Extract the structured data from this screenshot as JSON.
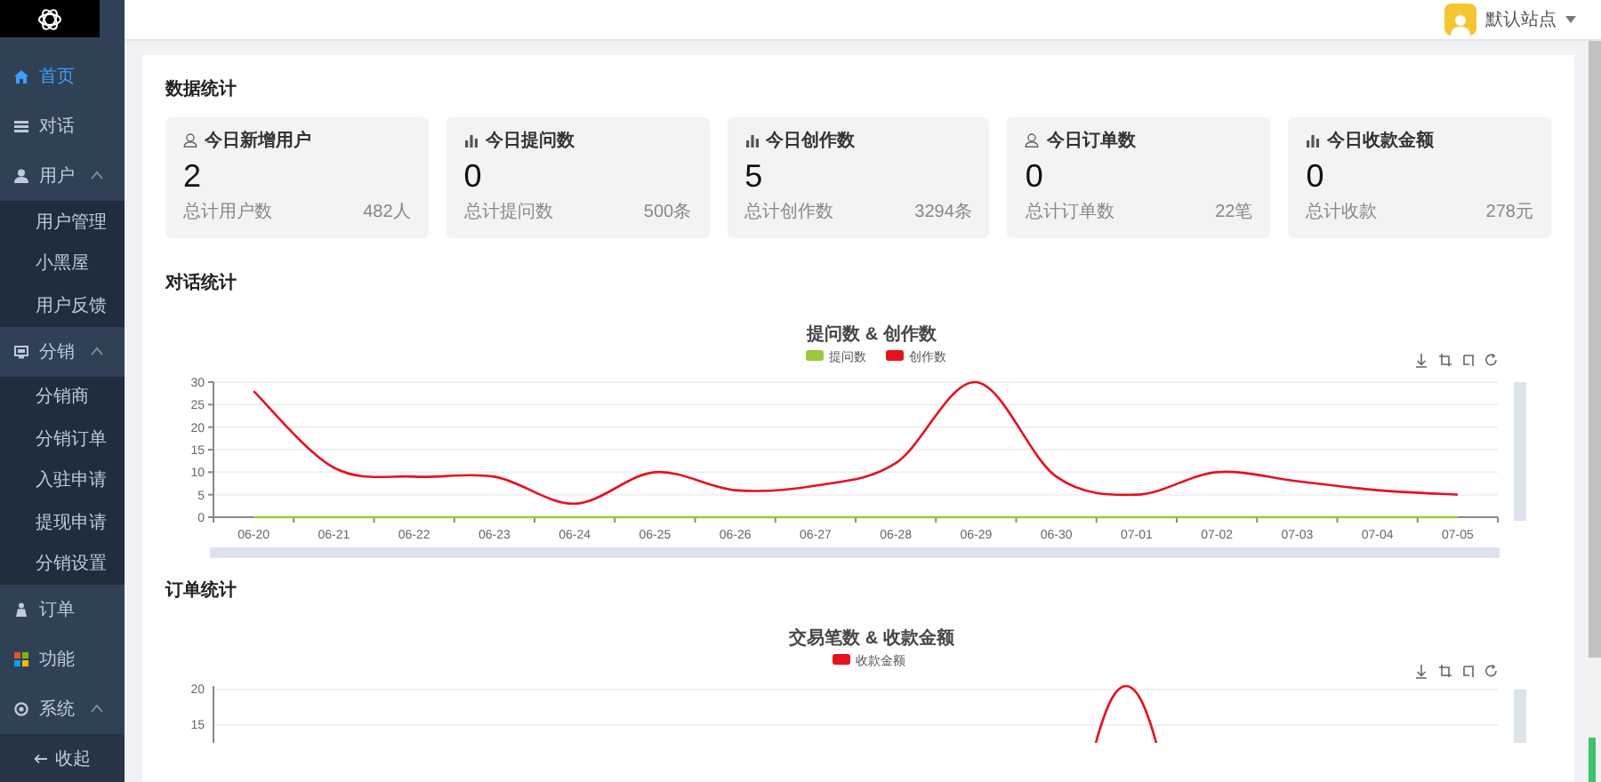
{
  "header": {
    "site": "默认站点"
  },
  "sidebar": {
    "items": [
      {
        "label": "首页",
        "selected": true
      },
      {
        "label": "对话",
        "selected": false
      },
      {
        "label": "用户",
        "selected": false,
        "expanded": true,
        "children": [
          {
            "label": "用户管理",
            "selected": false
          },
          {
            "label": "小黑屋",
            "selected": false
          },
          {
            "label": "用户反馈",
            "selected": false
          }
        ]
      },
      {
        "label": "分销",
        "selected": false,
        "expanded": true,
        "children": [
          {
            "label": "分销商",
            "selected": false
          },
          {
            "label": "分销订单",
            "selected": false
          },
          {
            "label": "入驻申请",
            "selected": false
          },
          {
            "label": "提现申请",
            "selected": false
          },
          {
            "label": "分销设置",
            "selected": false
          }
        ]
      },
      {
        "label": "订单",
        "selected": false
      },
      {
        "label": "功能",
        "selected": false
      },
      {
        "label": "系统",
        "selected": false,
        "expanded": true
      }
    ],
    "collapse": "收起"
  },
  "stats": {
    "title": "数据统计",
    "cards": [
      {
        "kind": "user",
        "title": "今日新增用户",
        "value": "2",
        "total_label": "总计用户数",
        "total_value": "482人"
      },
      {
        "kind": "chart",
        "title": "今日提问数",
        "value": "0",
        "total_label": "总计提问数",
        "total_value": "500条"
      },
      {
        "kind": "chart",
        "title": "今日创作数",
        "value": "5",
        "total_label": "总计创作数",
        "total_value": "3294条"
      },
      {
        "kind": "user",
        "title": "今日订单数",
        "value": "0",
        "total_label": "总计订单数",
        "total_value": "22笔"
      },
      {
        "kind": "chart",
        "title": "今日收款金额",
        "value": "0",
        "total_label": "总计收款",
        "total_value": "278元"
      }
    ]
  },
  "conversation_section": {
    "title": "对话统计",
    "chart_data": {
      "type": "line",
      "title": "提问数 & 创作数",
      "categories": [
        "06-20",
        "06-21",
        "06-22",
        "06-23",
        "06-24",
        "06-25",
        "06-26",
        "06-27",
        "06-28",
        "06-29",
        "06-30",
        "07-01",
        "07-02",
        "07-03",
        "07-04",
        "07-05"
      ],
      "series": [
        {
          "name": "提问数",
          "color": "#96c93d",
          "values": [
            0,
            0,
            0,
            0,
            0,
            0,
            0,
            0,
            0,
            0,
            0,
            0,
            0,
            0,
            0,
            0
          ]
        },
        {
          "name": "创作数",
          "color": "#e8101f",
          "values": [
            28,
            11,
            9,
            9,
            3,
            10,
            6,
            7,
            12,
            30,
            9,
            5,
            10,
            8,
            6,
            5
          ]
        }
      ],
      "ylim": [
        0,
        30
      ],
      "yticks": [
        0,
        5,
        10,
        15,
        20,
        25,
        30
      ],
      "grid": true,
      "legend": true
    },
    "x_zoom": {
      "level": 1
    },
    "y_zoom": {
      "level": 1
    }
  },
  "order_section": {
    "title": "订单统计",
    "chart_title": "交易笔数 & 收款金额",
    "legend": [
      {
        "name": "收款金额",
        "color": "#e8101f"
      }
    ],
    "ytick_labels": [
      "20",
      "15"
    ],
    "y_zoom": {
      "level": 1
    }
  }
}
